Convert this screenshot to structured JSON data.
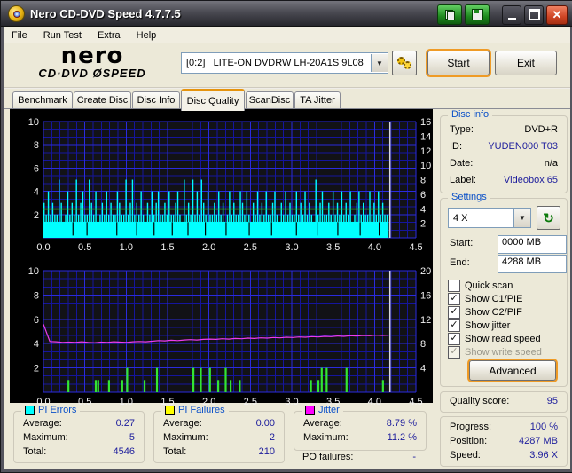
{
  "window": {
    "title": "Nero CD-DVD Speed 4.7.7.5"
  },
  "titlebar_buttons": {
    "copy": "copy",
    "save": "save",
    "minimize": "minimize",
    "maximize": "maximize",
    "close": "close"
  },
  "menu": {
    "items": [
      "File",
      "Run Test",
      "Extra",
      "Help"
    ]
  },
  "header": {
    "logo_top": "nero",
    "logo_bottom": "CD·DVD ØSPEED",
    "drive": "[0:2]   LITE-ON DVDRW LH-20A1S 9L08",
    "start_label": "Start",
    "exit_label": "Exit"
  },
  "tabs": {
    "items": [
      "Benchmark",
      "Create Disc",
      "Disc Info",
      "Disc Quality",
      "ScanDisc",
      "TA Jitter"
    ],
    "active": "Disc Quality"
  },
  "disc_info": {
    "title": "Disc info",
    "rows": [
      {
        "label": "Type:",
        "value": "DVD+R"
      },
      {
        "label": "ID:",
        "value": "YUDEN000 T03"
      },
      {
        "label": "Date:",
        "value": "n/a"
      },
      {
        "label": "Label:",
        "value": "Videobox 65"
      }
    ]
  },
  "settings": {
    "title": "Settings",
    "speed": "4 X",
    "start_label": "Start:",
    "start_value": "0000 MB",
    "end_label": "End:",
    "end_value": "4288 MB",
    "checkboxes": [
      {
        "label": "Quick scan",
        "checked": false,
        "disabled": false
      },
      {
        "label": "Show C1/PIE",
        "checked": true,
        "disabled": false
      },
      {
        "label": "Show C2/PIF",
        "checked": true,
        "disabled": false
      },
      {
        "label": "Show jitter",
        "checked": true,
        "disabled": false
      },
      {
        "label": "Show read speed",
        "checked": true,
        "disabled": false
      },
      {
        "label": "Show write speed",
        "checked": true,
        "disabled": true
      }
    ],
    "advanced_label": "Advanced"
  },
  "quality": {
    "label": "Quality score:",
    "value": "95"
  },
  "progress": {
    "rows": [
      {
        "label": "Progress:",
        "value": "100 %"
      },
      {
        "label": "Position:",
        "value": "4287 MB"
      },
      {
        "label": "Speed:",
        "value": "3.96 X"
      }
    ]
  },
  "stats": {
    "pi_errors": {
      "title": "PI Errors",
      "color": "#00ffff",
      "rows": [
        {
          "label": "Average:",
          "value": "0.27"
        },
        {
          "label": "Maximum:",
          "value": "5"
        },
        {
          "label": "Total:",
          "value": "4546"
        }
      ]
    },
    "pi_failures": {
      "title": "PI Failures",
      "color": "#ffff00",
      "rows": [
        {
          "label": "Average:",
          "value": "0.00"
        },
        {
          "label": "Maximum:",
          "value": "2"
        },
        {
          "label": "Total:",
          "value": "210"
        }
      ]
    },
    "jitter": {
      "title": "Jitter",
      "color": "#ff00ff",
      "rows": [
        {
          "label": "Average:",
          "value": "8.79 %"
        },
        {
          "label": "Maximum:",
          "value": "11.2 %"
        }
      ]
    },
    "po_label": "PO failures:",
    "po_value": "-"
  },
  "chart_data": [
    {
      "type": "bar",
      "title": "PI Errors vs disc position (GB) with read speed line",
      "x_ticks": [
        "0.0",
        "0.5",
        "1.0",
        "1.5",
        "2.0",
        "2.5",
        "3.0",
        "3.5",
        "4.0",
        "4.5"
      ],
      "x_max": 4.5,
      "data_end": 4.17,
      "left_ticks": [
        10,
        8,
        6,
        4,
        2
      ],
      "left_max": 10,
      "right_ticks": [
        16,
        14,
        12,
        10,
        8,
        6,
        4,
        2
      ],
      "right_max": 16,
      "pie_base": 1.38,
      "pie_bars": [
        3,
        2,
        4,
        2,
        3,
        2,
        2,
        5,
        3,
        1,
        2,
        4,
        2,
        3,
        2,
        5,
        2,
        3,
        4,
        2,
        2,
        5,
        3,
        2,
        4,
        1,
        2,
        3,
        2,
        4,
        2,
        3,
        2,
        2,
        4,
        3,
        2,
        2,
        5,
        2,
        3,
        5,
        2,
        3,
        2,
        4,
        2,
        1,
        3,
        2,
        4,
        2,
        3,
        4,
        2,
        2,
        3,
        2,
        4,
        2,
        2,
        3,
        4,
        2,
        1,
        5,
        2,
        3,
        2,
        5,
        2,
        4,
        2,
        5,
        3,
        2,
        4,
        2,
        2,
        3,
        2,
        4,
        2,
        3,
        1,
        2,
        4,
        2,
        3,
        2,
        2,
        4,
        3,
        2,
        4,
        2,
        1,
        3,
        2,
        4,
        2,
        3,
        2,
        4,
        2,
        2,
        3,
        4,
        2,
        1,
        3,
        2,
        4,
        2,
        3,
        2,
        2,
        4,
        2,
        3,
        2,
        4,
        2,
        3,
        2,
        1,
        5,
        2,
        3,
        4,
        2,
        2,
        3,
        2,
        4,
        2,
        3,
        2,
        4,
        2,
        3,
        2,
        4,
        1,
        2,
        3,
        4,
        2,
        3,
        2,
        2,
        4,
        2,
        3,
        2,
        4,
        2,
        3,
        2,
        2
      ],
      "notches": [
        0.35,
        0.52,
        0.88,
        1.12,
        1.33,
        1.55,
        1.74,
        1.95,
        2.2,
        2.48,
        2.75,
        3.05,
        3.3,
        3.55,
        3.82,
        4.05
      ],
      "read_speed_x": 3.96,
      "colors": {
        "pie": "#00ffff",
        "speed": "#3aa53a",
        "marker": "#d8d8d8",
        "grid_major": "#2b2bdd",
        "grid_minor": "#15159d",
        "plot_bg": "#121216"
      }
    },
    {
      "type": "line+bar",
      "title": "Jitter % and PI Failures vs disc position (GB)",
      "x_ticks": [
        "0.0",
        "0.5",
        "1.0",
        "1.5",
        "2.0",
        "2.5",
        "3.0",
        "3.5",
        "4.0",
        "4.5"
      ],
      "x_max": 4.5,
      "data_end": 4.17,
      "left_ticks": [
        10,
        8,
        6,
        4,
        2
      ],
      "left_max": 10,
      "right_ticks": [
        20,
        16,
        12,
        8,
        4
      ],
      "right_max": 20,
      "jitter_pct": [
        11.2,
        8.35,
        8.3,
        8.2,
        8.25,
        8.2,
        8.3,
        8.2,
        8.15,
        8.25,
        8.2,
        8.3,
        8.25,
        8.2,
        8.3,
        8.35,
        8.3,
        8.4,
        8.5,
        8.45,
        8.55,
        8.5,
        8.6,
        8.65,
        8.6,
        8.7,
        8.75,
        8.7,
        8.8,
        8.75,
        8.85,
        8.8,
        8.9,
        8.85,
        8.95,
        8.9,
        9.0,
        8.95,
        9.05,
        9.0,
        9.1,
        9.05,
        9.15,
        9.1,
        9.2,
        9.15,
        9.25,
        9.2,
        9.3,
        9.25,
        9.35,
        9.3,
        9.4,
        9.35,
        9.4
      ],
      "pif_bars": [
        [
          0.29,
          1
        ],
        [
          0.62,
          1
        ],
        [
          0.65,
          1
        ],
        [
          0.78,
          1
        ],
        [
          0.94,
          1
        ],
        [
          1.0,
          2
        ],
        [
          1.21,
          1
        ],
        [
          1.36,
          2
        ],
        [
          1.8,
          2
        ],
        [
          1.89,
          2
        ],
        [
          2.0,
          2
        ],
        [
          2.1,
          1
        ],
        [
          2.19,
          2
        ],
        [
          2.25,
          1
        ],
        [
          2.36,
          1
        ],
        [
          3.22,
          1
        ],
        [
          3.31,
          1
        ],
        [
          3.35,
          2
        ],
        [
          3.41,
          2
        ],
        [
          3.65,
          2
        ],
        [
          4.09,
          1
        ]
      ],
      "colors": {
        "jitter": "#ee3cee",
        "pif": "#33e633",
        "marker": "#d8d8d8",
        "grid_major": "#2b2bdd",
        "grid_minor": "#15159d",
        "plot_bg": "#121216"
      }
    }
  ]
}
